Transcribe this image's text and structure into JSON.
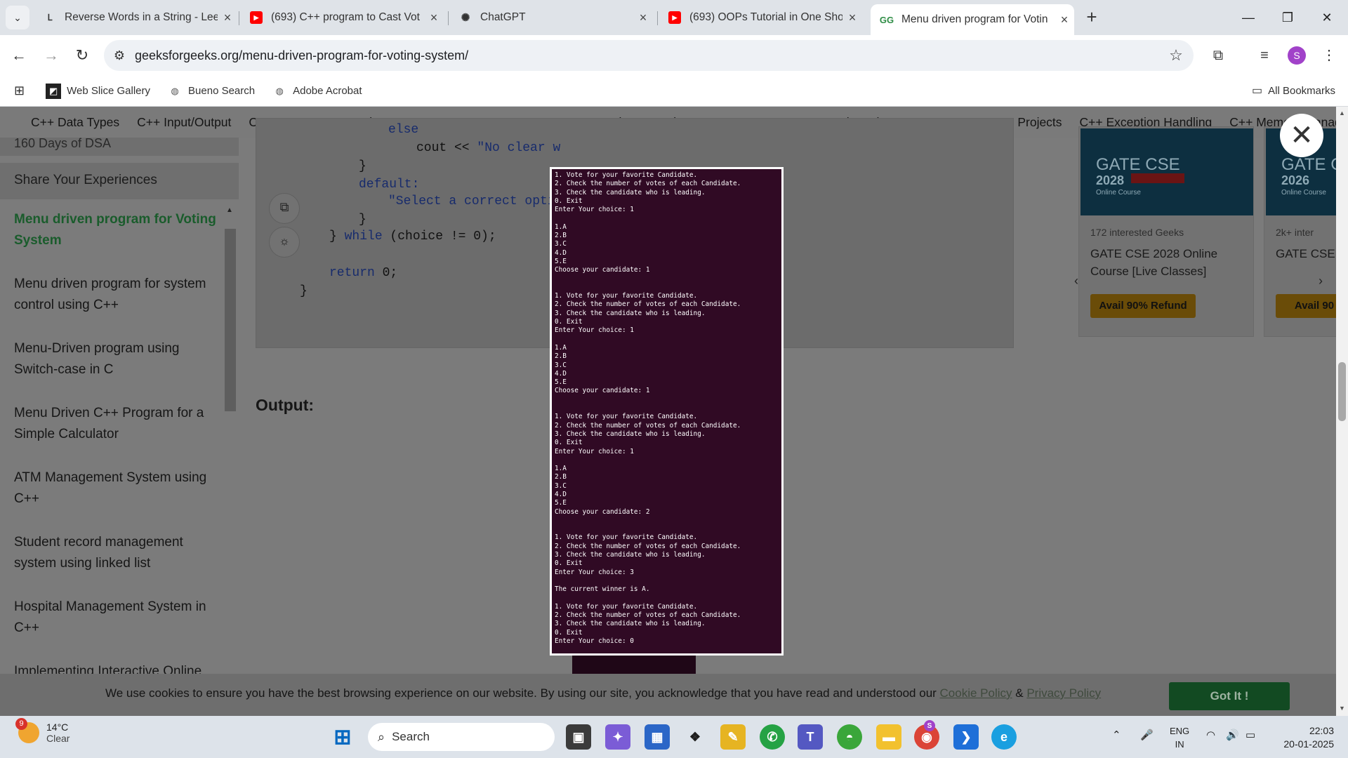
{
  "browser": {
    "tabs": [
      {
        "title": "Reverse Words in a String - Lee",
        "favicon": "leetcode-icon"
      },
      {
        "title": "(693) C++ program to Cast Vot",
        "favicon": "youtube-icon"
      },
      {
        "title": "ChatGPT",
        "favicon": "chatgpt-icon"
      },
      {
        "title": "(693) OOPs Tutorial in One Sho",
        "favicon": "youtube-icon"
      },
      {
        "title": "Menu driven program for Votin",
        "favicon": "gfg-icon",
        "active": true
      }
    ],
    "url": "geeksforgeeks.org/menu-driven-program-for-voting-system/",
    "bookmarks": [
      "Web Slice Gallery",
      "Bueno Search",
      "Adobe Acrobat"
    ],
    "all_bookmarks": "All Bookmarks",
    "profile_initial": "S"
  },
  "topnav": [
    "C++ Data Types",
    "C++ Input/Output",
    "C++ Arrays",
    "C++ Pointers",
    "C++ OOPs",
    "C++ STL",
    "C++ Interview Questions",
    "C++ Programs",
    "C++ Cheatsheet",
    "C++ MCQ",
    "C++ Projects",
    "C++ Exception Handling",
    "C++ Memory Managem"
  ],
  "sidebar": {
    "cut_item": "160 Days of DSA",
    "share": "Share Your Experiences",
    "items": [
      "Menu driven program for Voting System",
      "Menu driven program for system control using C++",
      "Menu-Driven program using Switch-case in C",
      "Menu Driven C++ Program for a Simple Calculator",
      "ATM Management System using C++",
      "Student record management system using linked list",
      "Hospital Management System in C++",
      "Implementing Interactive Online"
    ]
  },
  "code": {
    "else": "else",
    "cout": "cout << ",
    "cout_str": "\"No clear w",
    "close1": "}",
    "default": "default:",
    "default_str": "\"Select a correct optio",
    "close2": "}",
    "while_close": "} ",
    "while_kw": "while",
    "while_cond": " (choice != 0);",
    "return_kw": "return",
    "return_val": " 0;",
    "close3": "}"
  },
  "output_heading": "Output:",
  "terminal_lines": [
    "1. Vote for your favorite Candidate.",
    "2. Check the number of votes of each Candidate.",
    "3. Check the candidate who is leading.",
    "0. Exit",
    "Enter Your choice: 1",
    "",
    "1.A",
    "2.B",
    "3.C",
    "4.D",
    "5.E",
    "Choose your candidate: 1",
    "",
    "",
    "1. Vote for your favorite Candidate.",
    "2. Check the number of votes of each Candidate.",
    "3. Check the candidate who is leading.",
    "0. Exit",
    "Enter Your choice: 1",
    "",
    "1.A",
    "2.B",
    "3.C",
    "4.D",
    "5.E",
    "Choose your candidate: 1",
    "",
    "",
    "1. Vote for your favorite Candidate.",
    "2. Check the number of votes of each Candidate.",
    "3. Check the candidate who is leading.",
    "0. Exit",
    "Enter Your choice: 1",
    "",
    "1.A",
    "2.B",
    "3.C",
    "4.D",
    "5.E",
    "Choose your candidate: 2",
    "",
    "",
    "1. Vote for your favorite Candidate.",
    "2. Check the number of votes of each Candidate.",
    "3. Check the candidate who is leading.",
    "0. Exit",
    "Enter Your choice: 3",
    "",
    "The current winner is A.",
    "",
    "1. Vote for your favorite Candidate.",
    "2. Check the number of votes of each Candidate.",
    "3. Check the candidate who is leading.",
    "0. Exit",
    "Enter Your choice: 0"
  ],
  "ads": [
    {
      "img_title": "GATE CSE",
      "img_year": "2028",
      "img_sub": "Online Course",
      "interested": "172 interested Geeks",
      "title": "GATE CSE 2028 Online Course [Live Classes]",
      "button": "Avail 90% Refund"
    },
    {
      "img_title": "GATE C",
      "img_year": "2026",
      "img_sub": "Online Course",
      "interested": "2k+ inter",
      "title": "GATE CSE [Live Wee",
      "button": "Avail 90"
    }
  ],
  "cookie": {
    "text": "We use cookies to ensure you have the best browsing experience on our website. By using our site, you acknowledge that you have read and understood our ",
    "cookie_policy": "Cookie Policy",
    "amp": " & ",
    "privacy_policy": "Privacy Policy",
    "button": "Got It !"
  },
  "taskbar": {
    "weather_badge": "9",
    "temp": "14°C",
    "condition": "Clear",
    "search": "Search",
    "lang1": "ENG",
    "lang2": "IN",
    "time": "22:03",
    "date": "20-01-2025",
    "chrome_badge": "S"
  }
}
